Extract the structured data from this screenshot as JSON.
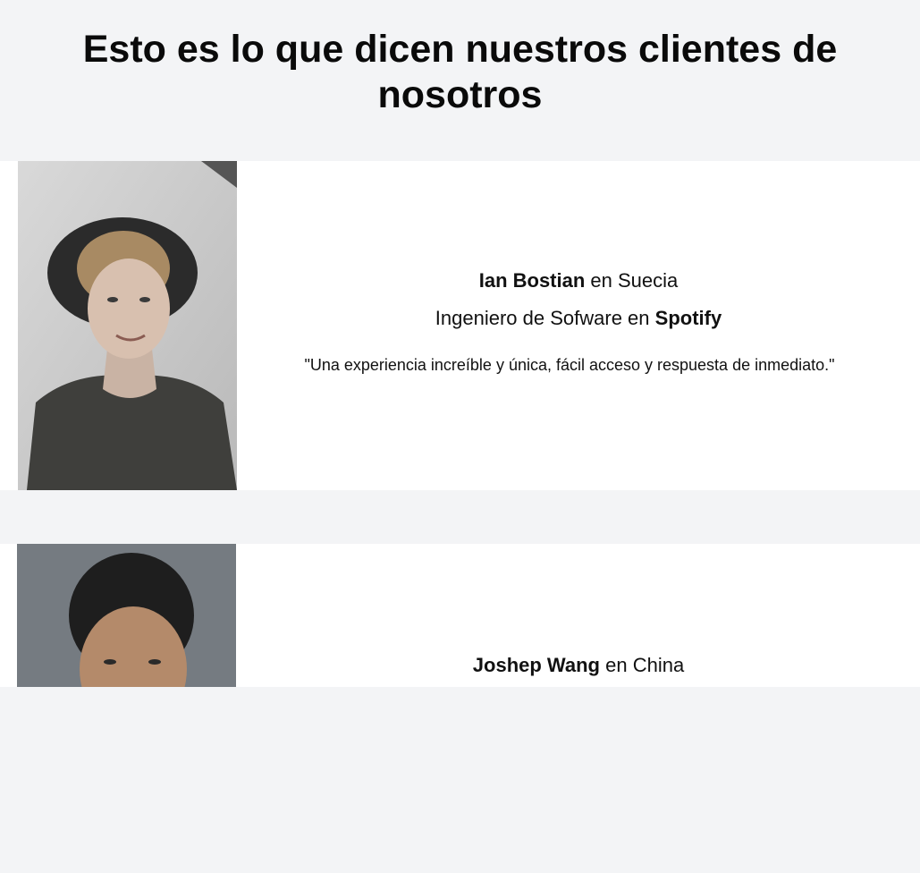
{
  "header": {
    "title": "Esto es lo que dicen nuestros clientes de nosotros"
  },
  "testimonials": [
    {
      "name": "Ian Bostian",
      "location_prefix": " en ",
      "location": "Suecia",
      "role": "Ingeniero de Sofware en ",
      "company": "Spotify",
      "quote": "\"Una experiencia increíble y única, fácil acceso y respuesta de inmediato.\""
    },
    {
      "name": "Joshep Wang",
      "location_prefix": " en ",
      "location": "China"
    }
  ],
  "colors": {
    "page_background": "#f3f4f6",
    "card_background": "#ffffff",
    "text": "#111111"
  }
}
